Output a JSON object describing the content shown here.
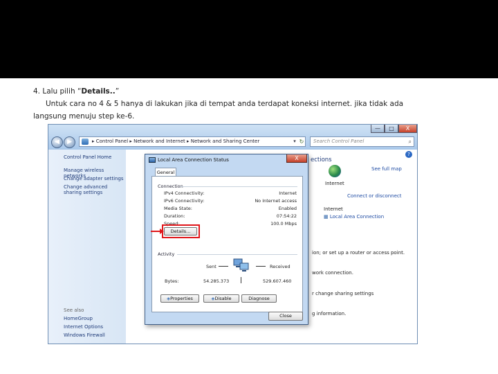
{
  "instructions": {
    "line1_prefix": "4. Lalu pilih “",
    "line1_bold": "Details..",
    "line1_suffix": "”",
    "line2": "Untuk cara no 4 & 5 hanya di lakukan jika di tempat anda terdapat koneksi internet. jika tidak ada",
    "line3": "langsung menuju step ke-6."
  },
  "window": {
    "controls": {
      "minimize": "—",
      "maximize": "□",
      "close": "X"
    },
    "nav": {
      "back": "◀",
      "forward": "▶"
    },
    "address": "▸ Control Panel ▸ Network and Internet ▸ Network and Sharing Center",
    "address_dropdown": "▾",
    "refresh": "↻",
    "search_placeholder": "Search Control Panel",
    "search_icon": "⌕",
    "help": "?"
  },
  "sidebar": {
    "home": "Control Panel Home",
    "links": [
      "Manage wireless networks",
      "Change adapter settings",
      "Change advanced sharing settings"
    ],
    "see_also": "See also",
    "see_also_links": [
      "HomeGroup",
      "Internet Options",
      "Windows Firewall"
    ]
  },
  "main": {
    "connections_heading": "ections",
    "full_map": "See full map",
    "internet_label": "Internet",
    "connect_disconnect": "Connect or disconnect",
    "access_type_label": "Internet",
    "connection_link": "Local Area Connection",
    "text_router": "ion; or set up a router or access point.",
    "text_network": "work connection.",
    "text_sharing": "r change sharing settings",
    "text_info": "g information."
  },
  "dialog": {
    "title": "Local Area Connection Status",
    "close": "X",
    "tab": "General",
    "connection_section": "Connection",
    "rows": [
      {
        "label": "IPv4 Connectivity:",
        "value": "Internet"
      },
      {
        "label": "IPv6 Connectivity:",
        "value": "No Internet access"
      },
      {
        "label": "Media State:",
        "value": "Enabled"
      },
      {
        "label": "Duration:",
        "value": "07:54:22"
      },
      {
        "label": "Speed:",
        "value": "100.0 Mbps"
      }
    ],
    "details_button": "Details...",
    "activity_section": "Activity",
    "sent_label": "Sent",
    "received_label": "Received",
    "bytes_label": "Bytes:",
    "bytes_sent": "54.285.373",
    "bytes_received": "529.607.460",
    "properties_button": "Properties",
    "disable_button": "Disable",
    "diagnose_button": "Diagnose",
    "close_button": "Close"
  },
  "colors": {
    "highlight": "#e0161a",
    "link": "#1e4ba3"
  }
}
